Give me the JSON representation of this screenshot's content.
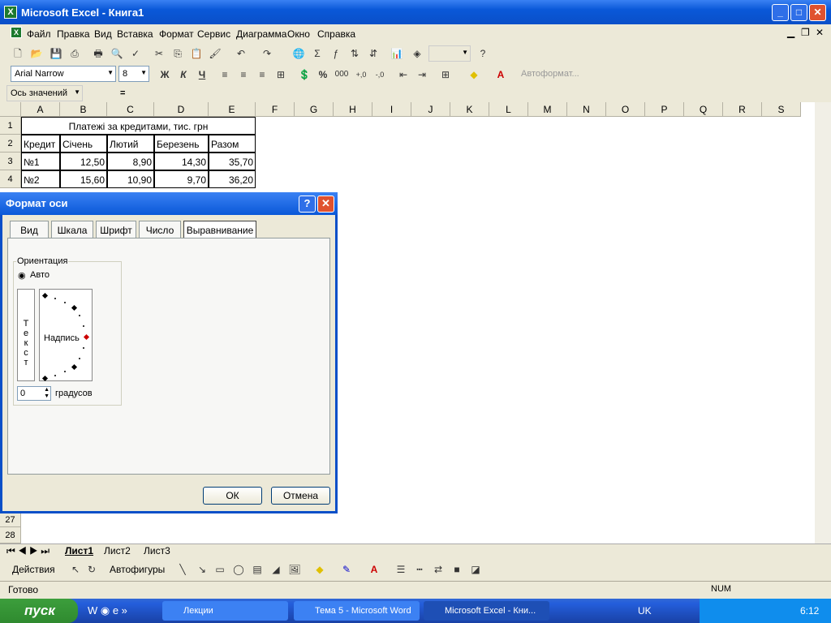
{
  "window": {
    "title": "Microsoft Excel - Книга1"
  },
  "menu": [
    "Файл",
    "Правка",
    "Вид",
    "Вставка",
    "Формат",
    "Сервис",
    "Диаграмма",
    "Окно",
    "Справка"
  ],
  "font": {
    "name": "Arial Narrow",
    "size": "8"
  },
  "toolbar": {
    "bold": "Ж",
    "italic": "К",
    "underline": "Ч",
    "percent": "%",
    "thousands": "000",
    "autoformat": "Автоформат..."
  },
  "formula": {
    "namebox": "Ось значений",
    "eq": "="
  },
  "sheet": {
    "columns": [
      "A",
      "B",
      "C",
      "D",
      "E",
      "F",
      "G",
      "H",
      "I",
      "J",
      "K",
      "L",
      "M",
      "N",
      "O",
      "P",
      "Q",
      "R",
      "S"
    ],
    "title": "Платежі за кредитами, тис. грн",
    "header": [
      "Кредит",
      "Січень",
      "Лютий",
      "Березень",
      "Разом"
    ],
    "rows": [
      [
        "№1",
        "12,50",
        "8,90",
        "14,30",
        "35,70"
      ],
      [
        "№2",
        "15,60",
        "10,90",
        "9,70",
        "36,20"
      ]
    ],
    "row_numbers": [
      "1",
      "2",
      "3",
      "4",
      "27",
      "28"
    ]
  },
  "tabs": [
    "Лист1",
    "Лист2",
    "Лист3"
  ],
  "drawing": {
    "actions": "Действия",
    "autoshapes": "Автофигуры"
  },
  "status": {
    "text": "Готово",
    "num": "NUM"
  },
  "taskbar": {
    "start": "пуск",
    "items": [
      "Лекции",
      "Тема 5 - Microsoft Word",
      "Microsoft Excel - Кни..."
    ],
    "lang": "UK",
    "clock": "6:12"
  },
  "dialog": {
    "title": "Формат оси",
    "tabs": [
      "Вид",
      "Шкала",
      "Шрифт",
      "Число",
      "Выравнивание"
    ],
    "orientation_label": "Ориентация",
    "auto_label": "Авто",
    "vertical_text": "Текст",
    "dial_label": "Надпись",
    "degrees_value": "0",
    "degrees_label": "градусов",
    "ok": "ОК",
    "cancel": "Отмена"
  }
}
